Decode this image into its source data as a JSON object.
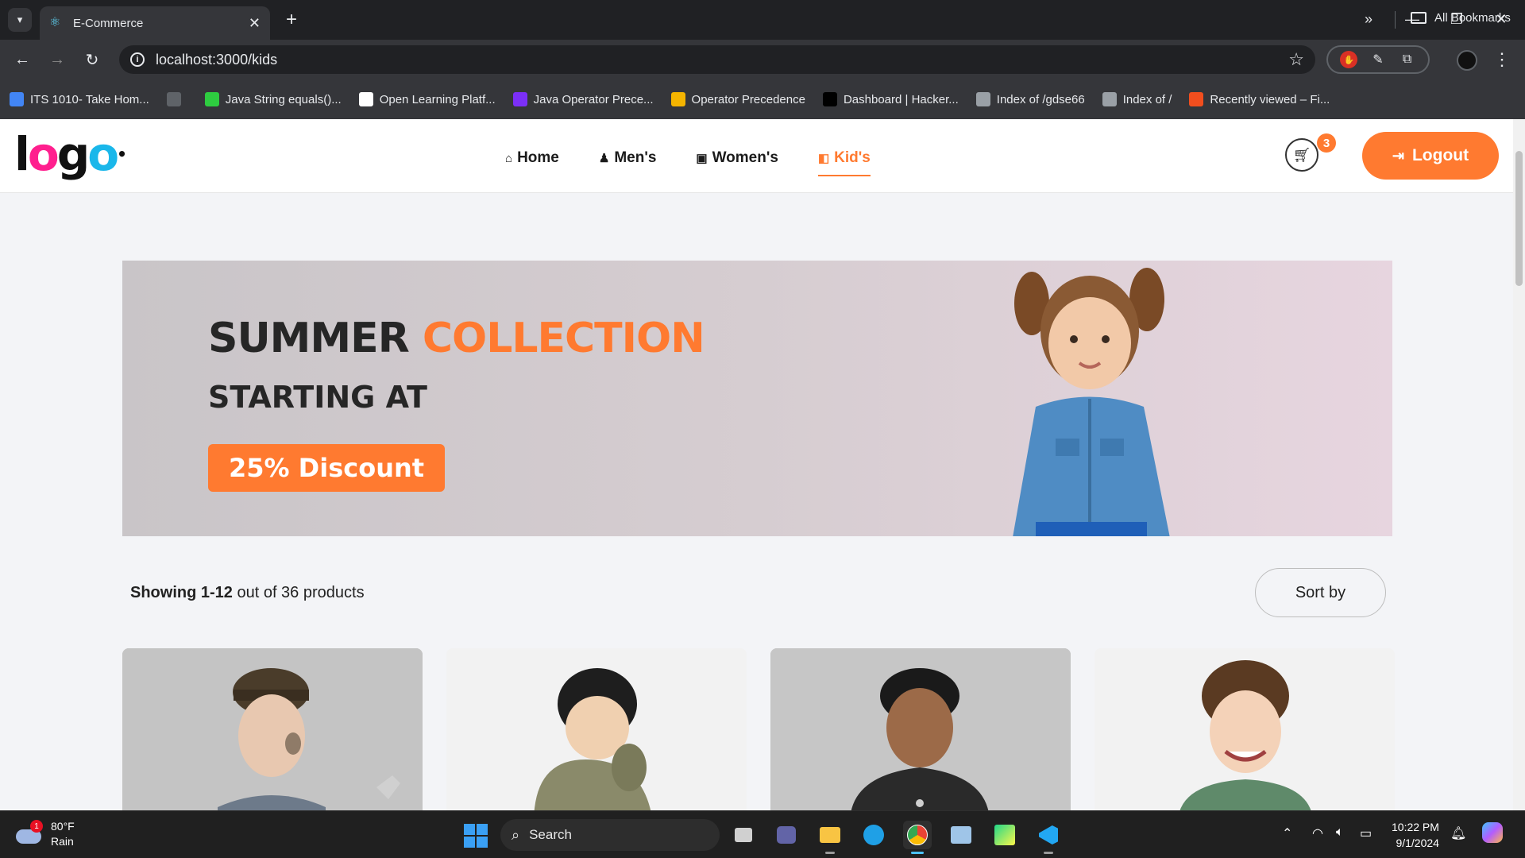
{
  "browser": {
    "tab_title": "E-Commerce",
    "url": "localhost:3000/kids",
    "bookmarks": [
      {
        "label": "ITS 1010- Take Hom...",
        "color": "#4285f4"
      },
      {
        "label": "",
        "color": "#5f6368"
      },
      {
        "label": "Java String equals()...",
        "color": "#2ecc40"
      },
      {
        "label": "Open Learning Platf...",
        "color": "#ffffff"
      },
      {
        "label": "Java Operator Prece...",
        "color": "#7b2ff7"
      },
      {
        "label": "Operator Precedence",
        "color": "#f4b400"
      },
      {
        "label": "Dashboard | Hacker...",
        "color": "#000000"
      },
      {
        "label": "Index of /gdse66",
        "color": "#9aa0a6"
      },
      {
        "label": "Index of /",
        "color": "#9aa0a6"
      },
      {
        "label": "Recently viewed – Fi...",
        "color": "#f24e1e"
      }
    ],
    "all_bookmarks_label": "All Bookmarks"
  },
  "site": {
    "logo": {
      "l": "l",
      "o1": "o",
      "g": "g",
      "o2": "o"
    },
    "nav": [
      {
        "label": "Home",
        "icon": "home-icon",
        "active": false
      },
      {
        "label": "Men's",
        "icon": "men-icon",
        "active": false
      },
      {
        "label": "Women's",
        "icon": "women-icon",
        "active": false
      },
      {
        "label": "Kid's",
        "icon": "kids-icon",
        "active": true
      }
    ],
    "cart_count": "3",
    "logout_label": "Logout",
    "accent_color": "#ff7a30"
  },
  "banner": {
    "line1_dark": "SUMMER ",
    "line1_accent": "COLLECTION",
    "line2": "STARTING AT",
    "cta": "25% Discount"
  },
  "listing": {
    "showing_range": "Showing 1-12",
    "showing_rest": " out of 36 products",
    "sort_label": "Sort by"
  },
  "taskbar": {
    "weather_temp": "80°F",
    "weather_cond": "Rain",
    "weather_badge": "1",
    "search_label": "Search",
    "time": "10:22 PM",
    "date": "9/1/2024"
  }
}
